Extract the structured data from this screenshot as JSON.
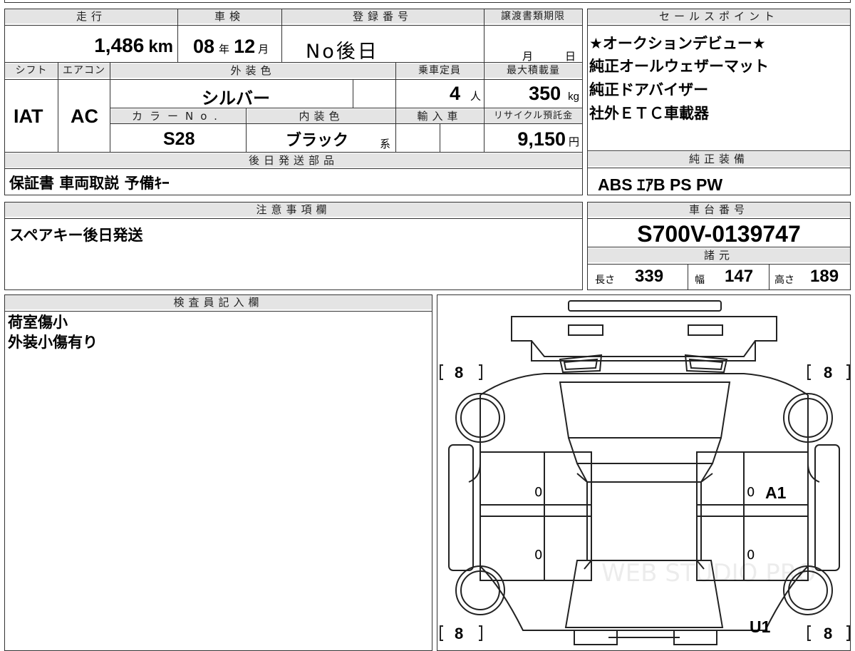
{
  "top": {
    "mileage": {
      "label": "走行",
      "value": "1,486",
      "unit": "km"
    },
    "inspection": {
      "label": "車検",
      "year": "08",
      "year_unit": "年",
      "month": "12",
      "month_unit": "月"
    },
    "registration": {
      "label": "登録番号",
      "value": "No後日"
    },
    "transfer_deadline": {
      "label": "譲渡書類期限",
      "month_unit": "月",
      "day_unit": "日"
    }
  },
  "row2": {
    "shift": {
      "label": "シフト",
      "value": "IAT"
    },
    "ac": {
      "label": "エアコン",
      "value": "AC"
    },
    "exterior_color": {
      "label": "外装色",
      "value": "シルバー"
    },
    "capacity": {
      "label": "乗車定員",
      "value": "4",
      "unit": "人"
    },
    "max_load": {
      "label": "最大積載量",
      "value": "350",
      "unit": "kg"
    },
    "color_no": {
      "label": "カラーNo.",
      "value": "S28"
    },
    "interior_color": {
      "label": "内装色",
      "value": "ブラック",
      "suffix": "系"
    },
    "import": {
      "label": "輸入車"
    },
    "recycle": {
      "label": "リサイクル預託金",
      "value": "9,150",
      "unit": "円"
    }
  },
  "later_parts": {
    "label": "後日発送部品",
    "value": "保証書 車両取説 予備ｷｰ"
  },
  "sales_points": {
    "label": "セールスポイント",
    "items": [
      "★オークションデビュー★",
      "純正オールウェザーマット",
      "純正ドアバイザー",
      "社外ＥＴＣ車載器"
    ]
  },
  "equipment": {
    "label": "純正装備",
    "value": "ABS ｴｱB PS PW"
  },
  "notes": {
    "label": "注意事項欄",
    "value": "スペアキー後日発送"
  },
  "chassis": {
    "label": "車台番号",
    "value": "S700V-0139747"
  },
  "specs": {
    "label": "諸元",
    "length_label": "長さ",
    "length": "339",
    "width_label": "幅",
    "width": "147",
    "height_label": "高さ",
    "height": "189"
  },
  "inspector": {
    "label": "検査員記入欄",
    "lines": [
      "荷室傷小",
      "外装小傷有り"
    ]
  },
  "diagram": {
    "tires": [
      "8",
      "8",
      "8",
      "8"
    ],
    "marks": [
      "0",
      "0",
      "0",
      "0"
    ],
    "annotations": [
      "A1",
      "U1"
    ],
    "watermark": "WEB STUDIO PRO"
  }
}
